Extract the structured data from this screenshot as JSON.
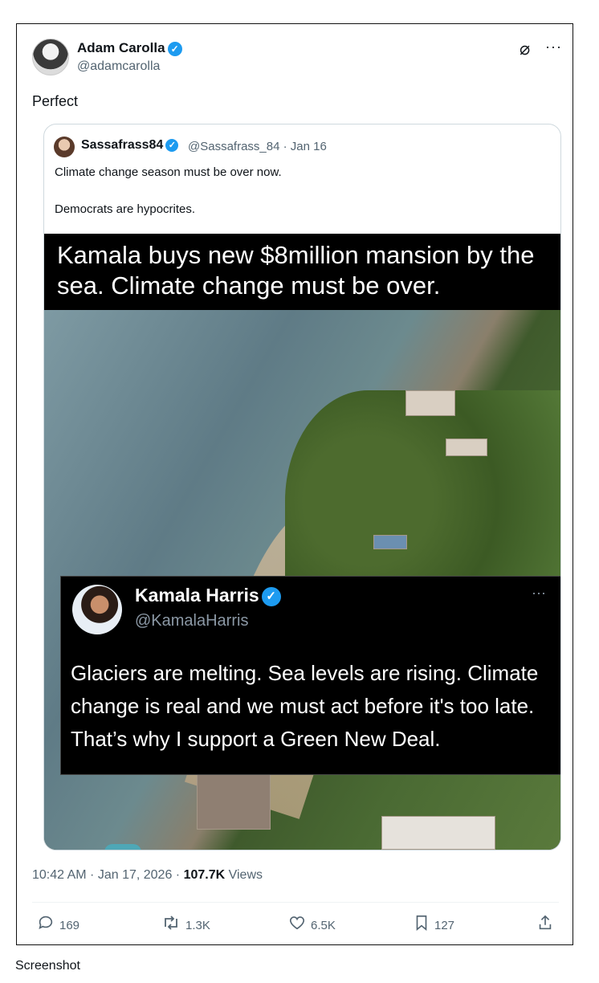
{
  "post": {
    "author_name": "Adam Carolla",
    "author_handle": "@adamcarolla",
    "text": "Perfect",
    "timestamp": "10:42 AM · Jan 17, 2026 · ",
    "views_count": "107.7K",
    "views_label": " Views"
  },
  "quoted": {
    "author_name": "Sassafrass84",
    "author_handle": "@Sassafrass_84 · Jan 16",
    "line1": "Climate change season must be over now.",
    "line2": "Democrats are hypocrites."
  },
  "meme": {
    "header": "Kamala buys new $8million mansion by the sea. Climate change must be over.",
    "inner_author_name": "Kamala Harris",
    "inner_author_handle": "@KamalaHarris",
    "inner_text": "Glaciers are melting. Sea levels are rising. Climate change is real and we must act before it's too late. That’s why I support a Green New Deal."
  },
  "actions": {
    "replies": "169",
    "reposts": "1.3K",
    "likes": "6.5K",
    "bookmarks": "127"
  },
  "icons": {
    "verified": "verified-badge-icon",
    "grok": "grok-icon",
    "more": "more-icon",
    "reply": "reply-icon",
    "repost": "repost-icon",
    "like": "heart-icon",
    "bookmark": "bookmark-icon",
    "share": "share-icon"
  },
  "colors": {
    "verified": "#1d9bf0",
    "secondary_text": "#536471"
  },
  "caption": "Screenshot"
}
